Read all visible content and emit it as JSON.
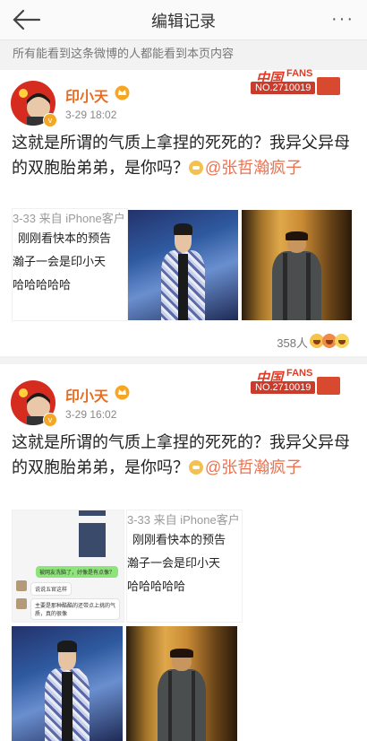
{
  "topbar": {
    "title": "编辑记录",
    "more_label": "···"
  },
  "notice": "所有能看到这条微博的人都能看到本页内容",
  "fans_badge": {
    "cn": "中国",
    "en": "FANS",
    "number": "NO.2710019"
  },
  "posts": [
    {
      "username": "印小天",
      "time": "3-29 18:02",
      "text_main": "这就是所谓的气质上拿捏的死死的？我异父异母的双胞胎弟弟，是你吗？",
      "mention": "@张哲瀚疯子",
      "chat_lines": [
        "3-33  来自 iPhone客户",
        "刚刚看快本的预告",
        "瀚子一会是印小天",
        "哈哈哈哈哈"
      ],
      "likes": "358人"
    },
    {
      "username": "印小天",
      "time": "3-29 16:02",
      "text_main": "这就是所谓的气质上拿捏的死死的？我异父异母的双胞胎弟弟，是你吗？",
      "mention": "@张哲瀚疯子",
      "chat_lines": [
        "3-33  来自 iPhone客户",
        "刚刚看快本的预告",
        "瀚子一会是印小天",
        "哈哈哈哈哈"
      ],
      "mini_chat": [
        "被网友洗脑了，好像是有点像？",
        "说说五官这样",
        "主要是那种酷酷的还带点上挑的气质，真的很像"
      ]
    }
  ]
}
